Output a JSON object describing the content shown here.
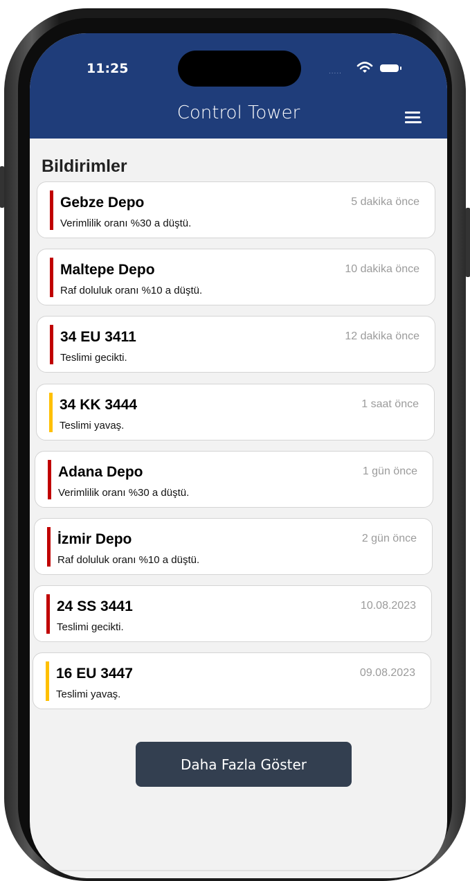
{
  "status_bar": {
    "time": "11:25",
    "signal_text": "....."
  },
  "header": {
    "title": "Control Tower"
  },
  "section": {
    "title": "Bildirimler"
  },
  "colors": {
    "critical": "#c00000",
    "warning": "#ffc000",
    "header_bg": "#1f3d7a",
    "button_bg": "#333f50"
  },
  "notifications": [
    {
      "name": "Gebze Depo",
      "message": "Verimlilik oranı %30 a düştü.",
      "time": "5 dakika önce",
      "severity": "critical"
    },
    {
      "name": "Maltepe Depo",
      "message": "Raf doluluk oranı %10 a düştü.",
      "time": "10 dakika önce",
      "severity": "critical"
    },
    {
      "name": "34 EU 3411",
      "message": "Teslimi gecikti.",
      "time": "12 dakika önce",
      "severity": "critical"
    },
    {
      "name": "34 KK 3444",
      "message": "Teslimi yavaş.",
      "time": "1 saat önce",
      "severity": "warning"
    },
    {
      "name": "Adana Depo",
      "message": "Verimlilik oranı %30 a düştü.",
      "time": "1 gün önce",
      "severity": "critical"
    },
    {
      "name": "İzmir Depo",
      "message": "Raf doluluk oranı %10 a düştü.",
      "time": "2 gün önce",
      "severity": "critical"
    },
    {
      "name": "24 SS 3441",
      "message": "Teslimi gecikti.",
      "time": "10.08.2023",
      "severity": "critical"
    },
    {
      "name": "16 EU 3447",
      "message": "Teslimi yavaş.",
      "time": "09.08.2023",
      "severity": "warning"
    }
  ],
  "actions": {
    "show_more_label": "Daha Fazla Göster"
  }
}
